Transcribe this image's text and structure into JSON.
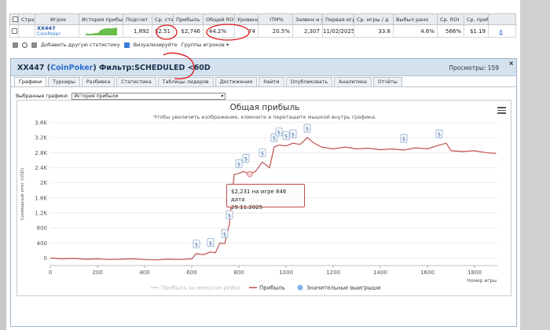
{
  "table": {
    "headers": [
      "",
      "Стра",
      "Игрок",
      "История прибы",
      "Подсчет",
      "Ср. ста",
      "Прибыль",
      "Общий RO",
      "Уровень",
      "ITM%",
      "Заявки и у",
      "Первая игр",
      "Ср. игры / д",
      "Выбыл рано",
      "Ср. ROI",
      "Ср. приб",
      ""
    ],
    "row": {
      "player": "XX447",
      "room": "CoinPoker",
      "count": "1,892",
      "avg_stake": "$2.51",
      "profit": "$2,746",
      "total_roi": "44.2%",
      "level": "74",
      "itm": "20.5%",
      "entries": "2,307",
      "first_game": "11/02/2025",
      "avg_games_day": "33.8",
      "early_out": "4.6%",
      "avg_roi": "566%",
      "avg_profit": "$1.19",
      "remove": "x"
    }
  },
  "toolbar": {
    "add_stat": "Добавить другую статистику",
    "visualize": "Визуализируйте",
    "groups": "Группы игроков"
  },
  "dialog": {
    "title_player": "XX447",
    "title_room": "CoinPoker",
    "title_filter": "Фильтр:SCHEDULED <60D",
    "views": "Просмотры: 159",
    "close": "×",
    "tabs": [
      "Графики",
      "Турниры",
      "Разбивка",
      "Статистика",
      "Таблицы лидеров",
      "Достижения",
      "Найти",
      "Опубликовать",
      "Аналитика",
      "Отчёты"
    ],
    "selected_label": "Выбранные графики:",
    "selected_value": "История прибыли"
  },
  "chart_data": {
    "type": "line",
    "title": "Общая прибыль",
    "subtitle": "Чтобы увеличить изображение, кликните и перетащите мышкой внутрь графика.",
    "xlabel": "Номер игры",
    "ylabel": "Суммарный итог (USD)",
    "xlim": [
      0,
      1900
    ],
    "ylim": [
      -200,
      3600
    ],
    "x_ticks": [
      "0",
      "200",
      "400",
      "600",
      "800",
      "1000",
      "1200",
      "1400",
      "1600",
      "1800"
    ],
    "y_ticks": [
      "0",
      "400",
      "800",
      "1.2K",
      "1.6K",
      "2K",
      "2.4K",
      "2.8K",
      "3.2K",
      "3.6K"
    ],
    "legend": [
      "Прибыль за минусом рейка",
      "Прибыль",
      "Значительные выигрыши"
    ],
    "series": [
      {
        "name": "Прибыль",
        "color": "#c0504d",
        "x": [
          0,
          50,
          100,
          150,
          200,
          250,
          300,
          350,
          400,
          450,
          500,
          550,
          600,
          620,
          650,
          680,
          700,
          720,
          740,
          760,
          780,
          800,
          820,
          846,
          870,
          900,
          930,
          950,
          970,
          1000,
          1030,
          1060,
          1090,
          1120,
          1150,
          1200,
          1250,
          1300,
          1350,
          1400,
          1450,
          1500,
          1550,
          1600,
          1650,
          1680,
          1700,
          1750,
          1800,
          1850,
          1890
        ],
        "y": [
          0,
          -20,
          -10,
          -30,
          -20,
          -40,
          -30,
          -20,
          -40,
          -50,
          -30,
          -40,
          -20,
          120,
          90,
          160,
          140,
          400,
          380,
          900,
          2220,
          2250,
          2300,
          2231,
          2300,
          2550,
          2400,
          2950,
          3000,
          2980,
          3050,
          3020,
          3200,
          3050,
          2950,
          2900,
          2950,
          2900,
          2920,
          2880,
          2900,
          2870,
          2930,
          2900,
          3000,
          3050,
          2850,
          2830,
          2850,
          2800,
          2780
        ]
      }
    ],
    "big_wins": [
      [
        620,
        120
      ],
      [
        680,
        160
      ],
      [
        740,
        400
      ],
      [
        760,
        900
      ],
      [
        800,
        2250
      ],
      [
        830,
        2400
      ],
      [
        900,
        2550
      ],
      [
        950,
        2950
      ],
      [
        970,
        3100
      ],
      [
        1000,
        3000
      ],
      [
        1030,
        3050
      ],
      [
        1090,
        3200
      ],
      [
        1500,
        2930
      ],
      [
        1650,
        3050
      ]
    ],
    "tooltip": {
      "line1": "$2,231 на игре 846 дата",
      "line2": "29.11.2025"
    }
  }
}
